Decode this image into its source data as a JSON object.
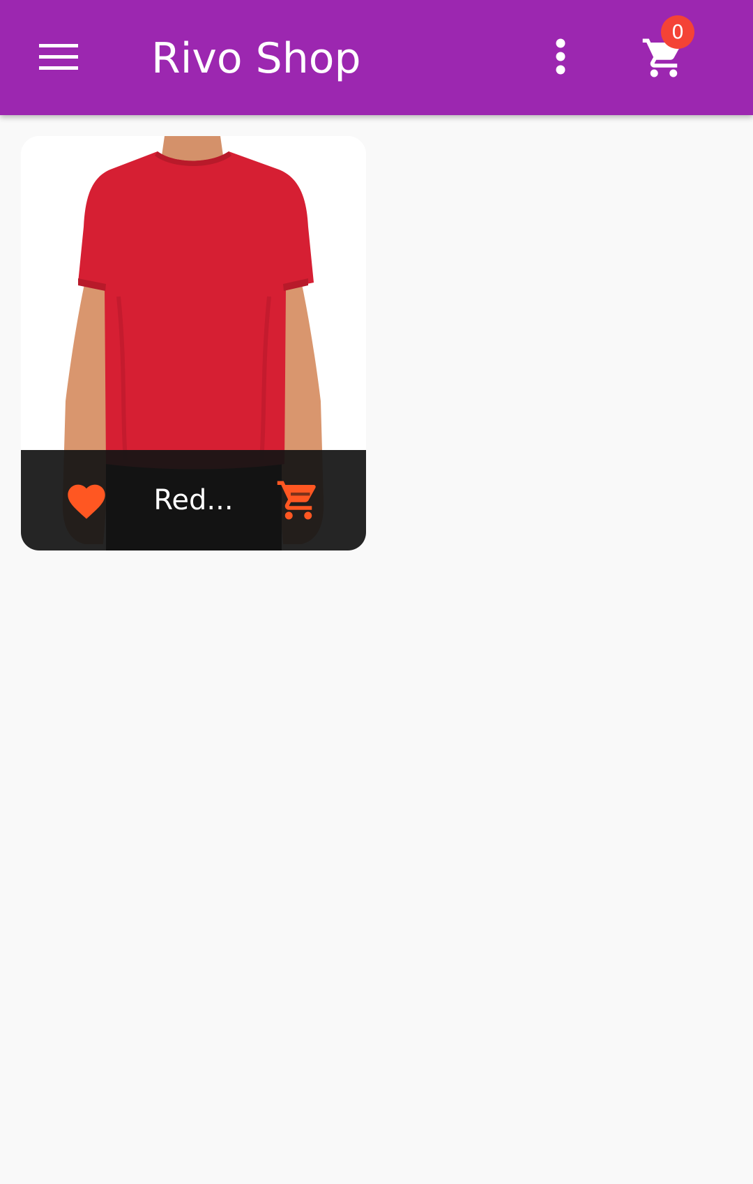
{
  "app_bar": {
    "title": "Rivo Shop",
    "menu_icon": "hamburger-menu-icon",
    "more_icon": "more-vert-icon",
    "cart_icon": "shopping-cart-icon",
    "cart_badge_count": "0",
    "background_color": "#9c27b0",
    "badge_color": "#f44336"
  },
  "products": [
    {
      "name": "Red...",
      "image": "red-tshirt-model-image",
      "favorite_icon": "heart-icon",
      "add_to_cart_icon": "add-shopping-cart-icon",
      "icon_color": "#ff5722"
    }
  ]
}
